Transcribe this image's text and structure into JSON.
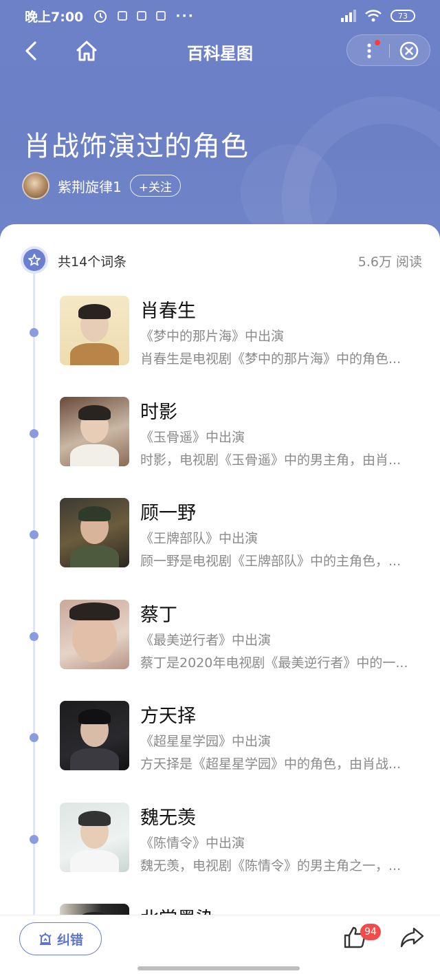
{
  "status_bar": {
    "time": "晚上7:00",
    "dots": "···",
    "battery": "73"
  },
  "nav": {
    "title": "百科星图"
  },
  "page": {
    "heading": "肖战饰演过的角色",
    "author": "紫荆旋律1",
    "follow_label": "+关注"
  },
  "summary": {
    "count": "共14个词条",
    "reads_value": "5.6万",
    "reads_label": "阅读"
  },
  "entries": [
    {
      "name": "肖春生",
      "sub": "《梦中的那片海》中出演",
      "desc": "肖春生是电视剧《梦中的那片海》中的角色..."
    },
    {
      "name": "时影",
      "sub": "《玉骨遥》中出演",
      "desc": "时影，电视剧《玉骨遥》中的男主角，由肖..."
    },
    {
      "name": "顾一野",
      "sub": "《王牌部队》中出演",
      "desc": "顾一野是电视剧《王牌部队》中的主角色，..."
    },
    {
      "name": "蔡丁",
      "sub": "《最美逆行者》中出演",
      "desc": "蔡丁是2020年电视剧《最美逆行者》中的一..."
    },
    {
      "name": "方天择",
      "sub": "《超星星学园》中出演",
      "desc": "方天择是《超星星学园》中的角色，由肖战..."
    },
    {
      "name": "魏无羡",
      "sub": "《陈情令》中出演",
      "desc": "魏无羡，电视剧《陈情令》的男主角之一，..."
    },
    {
      "name": "北堂墨染",
      "sub": "",
      "desc": ""
    }
  ],
  "bottom_bar": {
    "report_label": "纠错",
    "like_count": "94"
  },
  "colors": {
    "header_bg": "#6d81c9",
    "accent": "#6a7fd3",
    "badge_red": "#f24b4b"
  }
}
